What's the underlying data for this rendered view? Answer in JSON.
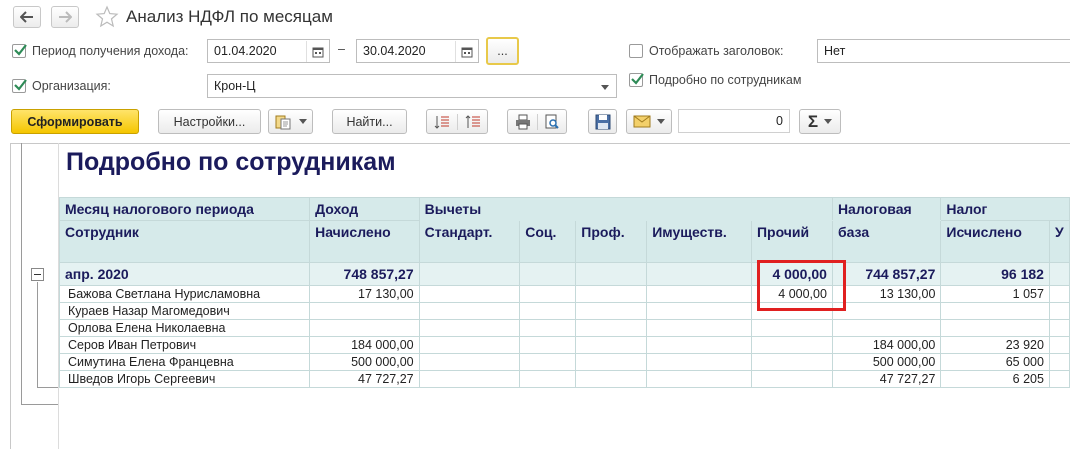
{
  "window": {
    "title": "Анализ НДФЛ по месяцам"
  },
  "params": {
    "period_label": "Период получения дохода:",
    "date_from": "01.04.2020",
    "dash": "–",
    "date_to": "30.04.2020",
    "period_btn": "...",
    "org_label": "Организация:",
    "org_value": "Крон-Ц",
    "show_header_label": "Отображать заголовок:",
    "show_header_value": "Нет",
    "detail_label": "Подробно по сотрудникам"
  },
  "toolbar": {
    "generate": "Сформировать",
    "settings": "Настройки...",
    "find": "Найти...",
    "sum_value": "0"
  },
  "report": {
    "title": "Подробно по сотрудникам",
    "header1": [
      "Месяц налогового периода",
      "Доход",
      "Вычеты",
      "Налоговая",
      "Налог"
    ],
    "header2": [
      "Сотрудник",
      "Начислено",
      "Стандарт.",
      "Соц.",
      "Проф.",
      "Имуществ.",
      "Прочий",
      "база",
      "Исчислено",
      "У"
    ],
    "group": {
      "month": "апр. 2020",
      "income": "748 857,27",
      "other": "4 000,00",
      "base": "744 857,27",
      "tax": "96 182"
    },
    "rows": [
      {
        "name": "Бажова Светлана Нурисламовна",
        "income": "17 130,00",
        "other": "4 000,00",
        "base": "13 130,00",
        "tax": "1 057"
      },
      {
        "name": "Кураев Назар Магомедович",
        "income": "",
        "other": "",
        "base": "",
        "tax": ""
      },
      {
        "name": "Орлова Елена Николаевна",
        "income": "",
        "other": "",
        "base": "",
        "tax": ""
      },
      {
        "name": "Серов Иван Петрович",
        "income": "184 000,00",
        "other": "",
        "base": "184 000,00",
        "tax": "23 920"
      },
      {
        "name": "Симутина Елена Францевна",
        "income": "500 000,00",
        "other": "",
        "base": "500 000,00",
        "tax": "65 000"
      },
      {
        "name": "Шведов Игорь Сергеевич",
        "income": "47 727,27",
        "other": "",
        "base": "47 727,27",
        "tax": "6 205"
      }
    ]
  },
  "colors": {
    "accent": "#f5c600",
    "header_bg": "#d6eaea",
    "group_bg": "#e5f2f2",
    "highlight": "#e02020",
    "title_text": "#1b1b5c"
  }
}
